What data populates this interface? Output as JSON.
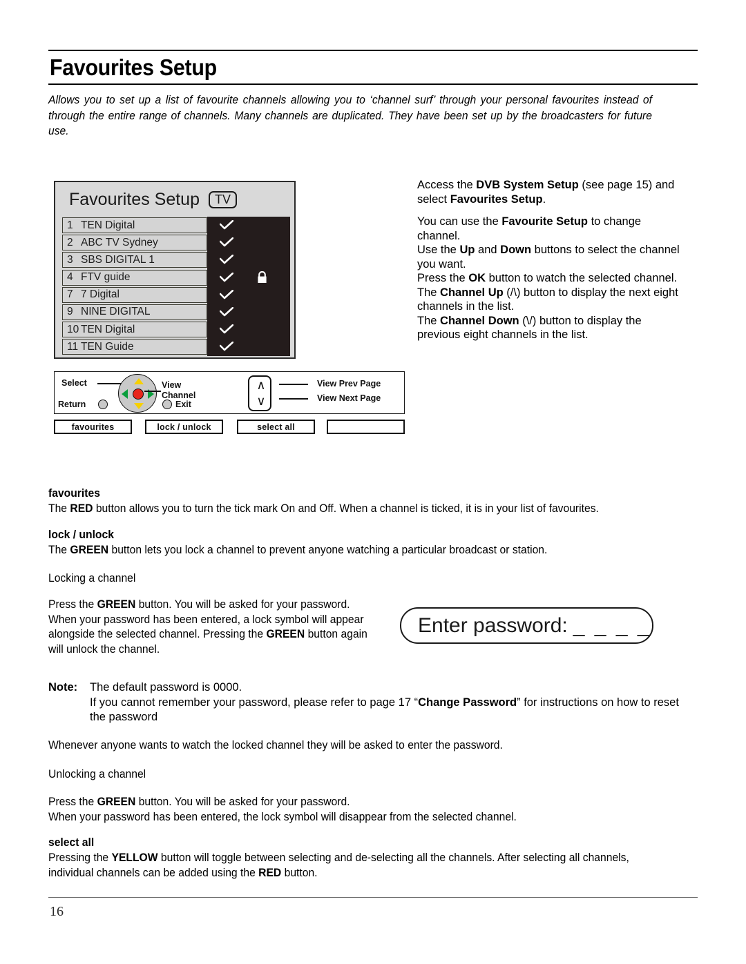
{
  "document": {
    "title": "Favourites Setup",
    "intro": "Allows you to set up a list of favourite channels allowing you to ‘channel surf’ through your personal favourites instead of through the entire range of channels. Many channels are duplicated. They have been set up by the broadcasters for future use.",
    "page_number": "16"
  },
  "tv_screen": {
    "title": "Favourites Setup",
    "badge": "TV",
    "rows": [
      {
        "number": "1",
        "name": "TEN Digital",
        "ticked": true,
        "locked": false
      },
      {
        "number": "2",
        "name": "ABC TV Sydney",
        "ticked": true,
        "locked": false
      },
      {
        "number": "3",
        "name": "SBS DIGITAL 1",
        "ticked": true,
        "locked": false
      },
      {
        "number": "4",
        "name": "FTV guide",
        "ticked": true,
        "locked": true
      },
      {
        "number": "7",
        "name": "7 Digital",
        "ticked": true,
        "locked": false
      },
      {
        "number": "9",
        "name": "NINE DIGITAL",
        "ticked": true,
        "locked": false
      },
      {
        "number": "10",
        "name": "TEN Digital",
        "ticked": true,
        "locked": false
      },
      {
        "number": "11",
        "name": "TEN Guide",
        "ticked": true,
        "locked": false
      }
    ],
    "colors": {
      "panel_background": "#d9d9d9",
      "row_label_background": "#d4d4d4",
      "row_status_background": "#241c1c",
      "border": "#2b2b2b"
    }
  },
  "remote_diagram": {
    "select_label": "Select",
    "return_label": "Return",
    "view_label": "View",
    "channel_label": "Channel",
    "exit_label": "Exit",
    "view_prev_page_label": "View Prev Page",
    "view_next_page_label": "View Next Page",
    "chevron_up": "∧",
    "chevron_down": "∨",
    "colors": {
      "dpad_face": "#c9c9c9",
      "ok_button": "#e8261b",
      "up_down_arrows": "#f7d000",
      "left_right_arrows": "#0a9e3c"
    }
  },
  "colour_buttons": [
    {
      "label": "favourites"
    },
    {
      "label": "lock / unlock"
    },
    {
      "label": "select all"
    },
    {
      "label": ""
    }
  ],
  "instructions": {
    "para1": {
      "a": "Access the ",
      "b1": "DVB System Setup",
      "c": " (see page 15) and select ",
      "b2": "Favourites Setup",
      "d": "."
    },
    "para2": {
      "a": "You can use the ",
      "b1": "Favourite Setup",
      "c": " to change channel.",
      "line2a": "Use the ",
      "b2": "Up",
      "line2b": " and ",
      "b3": "Down",
      "line2c": " buttons to select the channel you want.",
      "line3a": "Press the ",
      "b4": "OK",
      "line3b": " button to watch the selected channel.",
      "line4a": "The ",
      "b5": "Channel Up",
      "line4b": " (/\\) button to display the next eight channels in the list.",
      "line5a": "The ",
      "b6": "Channel Down",
      "line5b": " (\\/) button to display the previous eight channels in the list."
    }
  },
  "sections": {
    "favourites": {
      "heading": "favourites",
      "text_a": "The ",
      "bold_1": "RED",
      "text_b": " button allows you to turn the tick mark On and Off. When a channel is ticked, it is in your list of favourites."
    },
    "lock_unlock": {
      "heading": "lock / unlock",
      "text_a": "The ",
      "bold_1": "GREEN",
      "text_b": " button lets you lock a channel to prevent anyone watching a particular broadcast or station."
    },
    "locking_a_channel": {
      "text": "Locking a channel"
    },
    "press_green": {
      "text_a": "Press the ",
      "bold_1": "GREEN",
      "text_b": " button. You will be asked for your password.",
      "text_c": "When your password has been entered, a lock symbol will appear alongside the selected channel. Pressing the ",
      "bold_2": "GREEN",
      "text_d": " button again will unlock the channel."
    },
    "note": {
      "label": "Note:",
      "line1": "The default password is 0000.",
      "line2_a": "If you cannot remember your password, please refer to page 17 “",
      "bold_1": "Change Password",
      "line2_b": "” for instructions on how to reset the password"
    },
    "whenever": {
      "text": "Whenever anyone wants to watch the locked channel they will be asked to enter the password."
    },
    "unlocking_a_channel": {
      "text": "Unlocking a channel"
    },
    "press_green_2": {
      "text_a": "Press the ",
      "bold_1": "GREEN",
      "text_b": " button. You will be asked for your password.",
      "text_c": "When your password has been entered, the lock symbol will disappear from the selected channel."
    },
    "select_all": {
      "heading": "select all",
      "text_a": "Pressing the ",
      "bold_1": "YELLOW",
      "text_b": " button will toggle between selecting and de-selecting all the channels. After selecting all channels, individual channels can be added using the ",
      "bold_2": "RED",
      "text_c": " button."
    }
  },
  "password_dialog": {
    "label": "Enter password:",
    "dashes": "_ _ _ _"
  }
}
